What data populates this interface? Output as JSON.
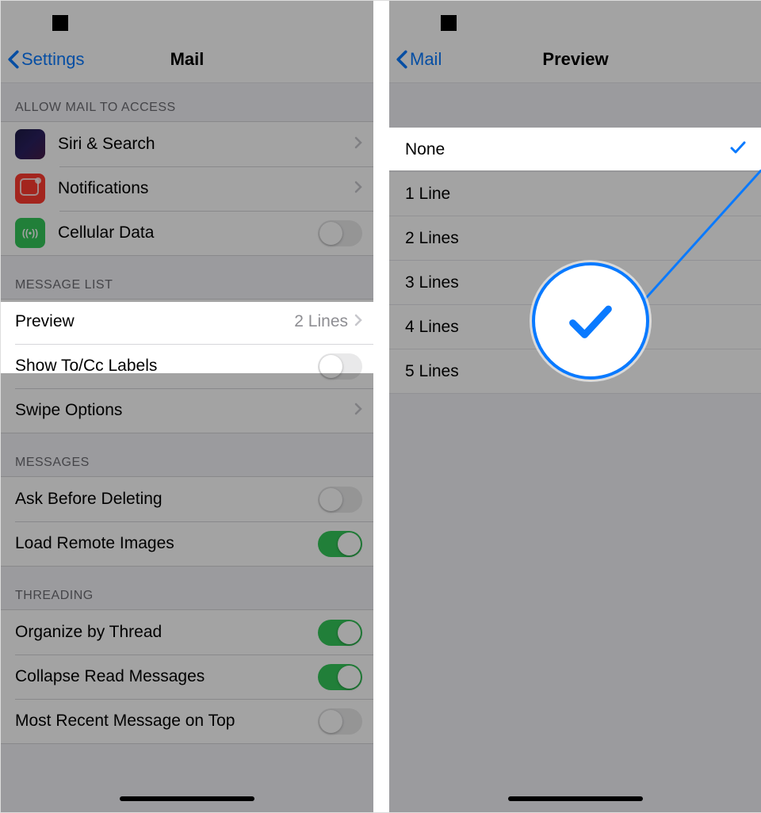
{
  "left": {
    "nav": {
      "back": "Settings",
      "title": "Mail"
    },
    "s1_header": "ALLOW MAIL TO ACCESS",
    "s1": {
      "siri": "Siri & Search",
      "notif": "Notifications",
      "cell": "Cellular Data"
    },
    "s2_header": "MESSAGE LIST",
    "s2": {
      "preview": "Preview",
      "preview_val": "2 Lines",
      "tocc": "Show To/Cc Labels",
      "swipe": "Swipe Options"
    },
    "s3_header": "MESSAGES",
    "s3": {
      "ask": "Ask Before Deleting",
      "load": "Load Remote Images"
    },
    "s4_header": "THREADING",
    "s4": {
      "org": "Organize by Thread",
      "col": "Collapse Read Messages",
      "mrm": "Most Recent Message on Top"
    }
  },
  "right": {
    "nav": {
      "back": "Mail",
      "title": "Preview"
    },
    "opts": [
      "None",
      "1 Line",
      "2 Lines",
      "3 Lines",
      "4 Lines",
      "5 Lines"
    ],
    "selected": "None"
  }
}
